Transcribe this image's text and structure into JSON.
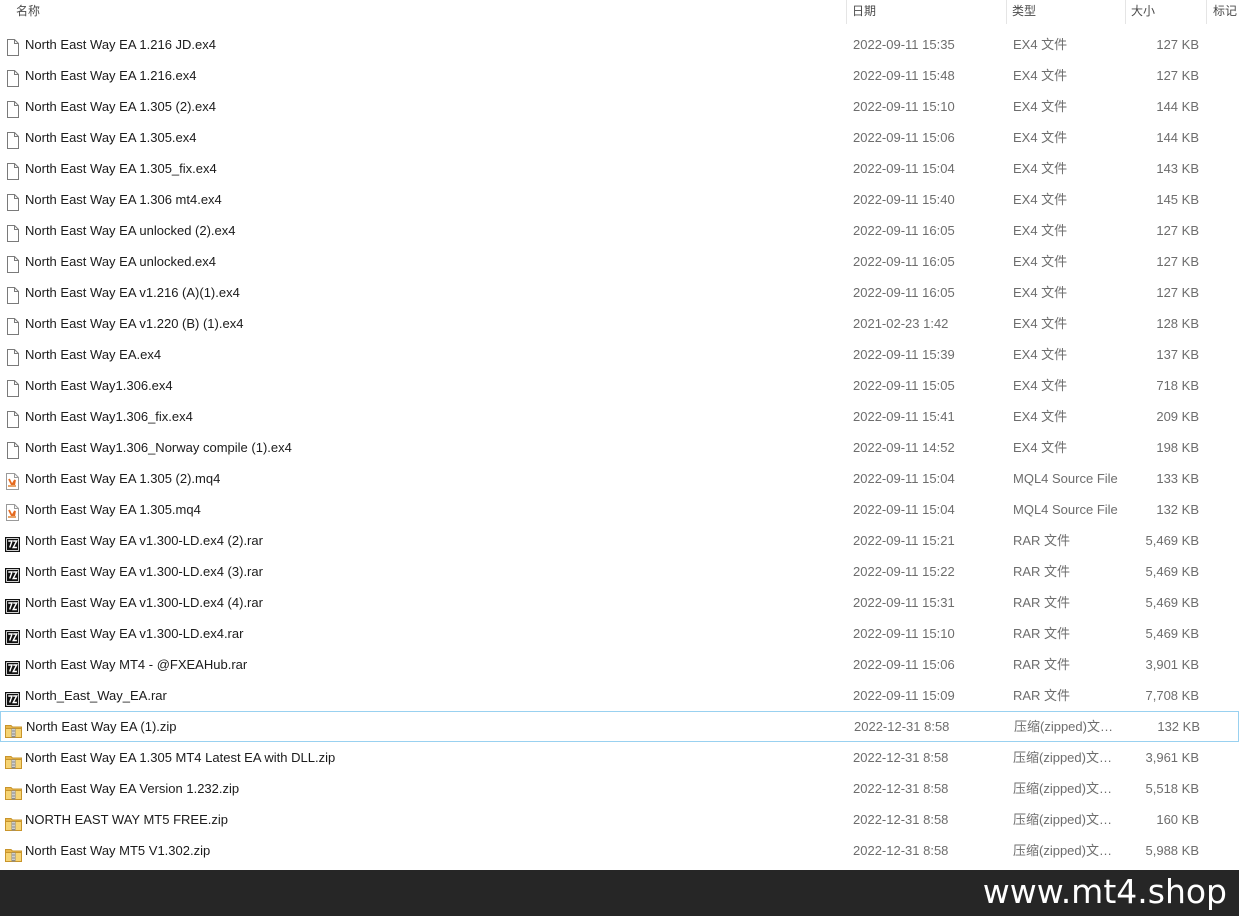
{
  "columns": {
    "name": "名称",
    "date": "日期",
    "type": "类型",
    "size": "大小",
    "tags": "标记"
  },
  "sort_indicator": "^",
  "files": [
    {
      "name": "North East Way EA 1.216 JD.ex4",
      "date": "2022-09-11 15:35",
      "type": "EX4 文件",
      "size": "127 KB",
      "icon": "file-icon"
    },
    {
      "name": "North East Way EA 1.216.ex4",
      "date": "2022-09-11 15:48",
      "type": "EX4 文件",
      "size": "127 KB",
      "icon": "file-icon"
    },
    {
      "name": "North East Way EA 1.305 (2).ex4",
      "date": "2022-09-11 15:10",
      "type": "EX4 文件",
      "size": "144 KB",
      "icon": "file-icon"
    },
    {
      "name": "North East Way EA 1.305.ex4",
      "date": "2022-09-11 15:06",
      "type": "EX4 文件",
      "size": "144 KB",
      "icon": "file-icon"
    },
    {
      "name": "North East Way EA 1.305_fix.ex4",
      "date": "2022-09-11 15:04",
      "type": "EX4 文件",
      "size": "143 KB",
      "icon": "file-icon"
    },
    {
      "name": "North East Way EA 1.306 mt4.ex4",
      "date": "2022-09-11 15:40",
      "type": "EX4 文件",
      "size": "145 KB",
      "icon": "file-icon"
    },
    {
      "name": "North East Way EA unlocked (2).ex4",
      "date": "2022-09-11 16:05",
      "type": "EX4 文件",
      "size": "127 KB",
      "icon": "file-icon"
    },
    {
      "name": "North East Way EA unlocked.ex4",
      "date": "2022-09-11 16:05",
      "type": "EX4 文件",
      "size": "127 KB",
      "icon": "file-icon"
    },
    {
      "name": "North East Way EA v1.216 (A)(1).ex4",
      "date": "2022-09-11 16:05",
      "type": "EX4 文件",
      "size": "127 KB",
      "icon": "file-icon"
    },
    {
      "name": "North East Way EA v1.220 (B) (1).ex4",
      "date": "2021-02-23 1:42",
      "type": "EX4 文件",
      "size": "128 KB",
      "icon": "file-icon"
    },
    {
      "name": "North East Way EA.ex4",
      "date": "2022-09-11 15:39",
      "type": "EX4 文件",
      "size": "137 KB",
      "icon": "file-icon"
    },
    {
      "name": "North East Way1.306.ex4",
      "date": "2022-09-11 15:05",
      "type": "EX4 文件",
      "size": "718 KB",
      "icon": "file-icon"
    },
    {
      "name": "North East Way1.306_fix.ex4",
      "date": "2022-09-11 15:41",
      "type": "EX4 文件",
      "size": "209 KB",
      "icon": "file-icon"
    },
    {
      "name": "North East Way1.306_Norway compile (1).ex4",
      "date": "2022-09-11 14:52",
      "type": "EX4 文件",
      "size": "198 KB",
      "icon": "file-icon"
    },
    {
      "name": "North East Way EA 1.305 (2).mq4",
      "date": "2022-09-11 15:04",
      "type": "MQL4 Source File",
      "size": "133 KB",
      "icon": "mql4-icon"
    },
    {
      "name": "North East Way EA 1.305.mq4",
      "date": "2022-09-11 15:04",
      "type": "MQL4 Source File",
      "size": "132 KB",
      "icon": "mql4-icon"
    },
    {
      "name": "North East Way EA v1.300-LD.ex4 (2).rar",
      "date": "2022-09-11 15:21",
      "type": "RAR 文件",
      "size": "5,469 KB",
      "icon": "7z-archive-icon"
    },
    {
      "name": "North East Way EA v1.300-LD.ex4 (3).rar",
      "date": "2022-09-11 15:22",
      "type": "RAR 文件",
      "size": "5,469 KB",
      "icon": "7z-archive-icon"
    },
    {
      "name": "North East Way EA v1.300-LD.ex4 (4).rar",
      "date": "2022-09-11 15:31",
      "type": "RAR 文件",
      "size": "5,469 KB",
      "icon": "7z-archive-icon"
    },
    {
      "name": "North East Way EA v1.300-LD.ex4.rar",
      "date": "2022-09-11 15:10",
      "type": "RAR 文件",
      "size": "5,469 KB",
      "icon": "7z-archive-icon"
    },
    {
      "name": "North East Way MT4 - @FXEAHub.rar",
      "date": "2022-09-11 15:06",
      "type": "RAR 文件",
      "size": "3,901 KB",
      "icon": "7z-archive-icon"
    },
    {
      "name": "North_East_Way_EA.rar",
      "date": "2022-09-11 15:09",
      "type": "RAR 文件",
      "size": "7,708 KB",
      "icon": "7z-archive-icon"
    },
    {
      "name": "North East Way EA (1).zip",
      "date": "2022-12-31 8:58",
      "type": "压缩(zipped)文件夹",
      "size": "132 KB",
      "icon": "zip-folder-icon",
      "focused": true
    },
    {
      "name": "North East Way EA 1.305 MT4 Latest EA with DLL.zip",
      "date": "2022-12-31 8:58",
      "type": "压缩(zipped)文件夹",
      "size": "3,961 KB",
      "icon": "zip-folder-icon"
    },
    {
      "name": "North East Way EA Version 1.232.zip",
      "date": "2022-12-31 8:58",
      "type": "压缩(zipped)文件夹",
      "size": "5,518 KB",
      "icon": "zip-folder-icon"
    },
    {
      "name": "NORTH EAST WAY MT5 FREE.zip",
      "date": "2022-12-31 8:58",
      "type": "压缩(zipped)文件夹",
      "size": "160 KB",
      "icon": "zip-folder-icon"
    },
    {
      "name": "North East Way MT5 V1.302.zip",
      "date": "2022-12-31 8:58",
      "type": "压缩(zipped)文件夹",
      "size": "5,988 KB",
      "icon": "zip-folder-icon"
    }
  ],
  "watermark": "www.mt4.shop"
}
